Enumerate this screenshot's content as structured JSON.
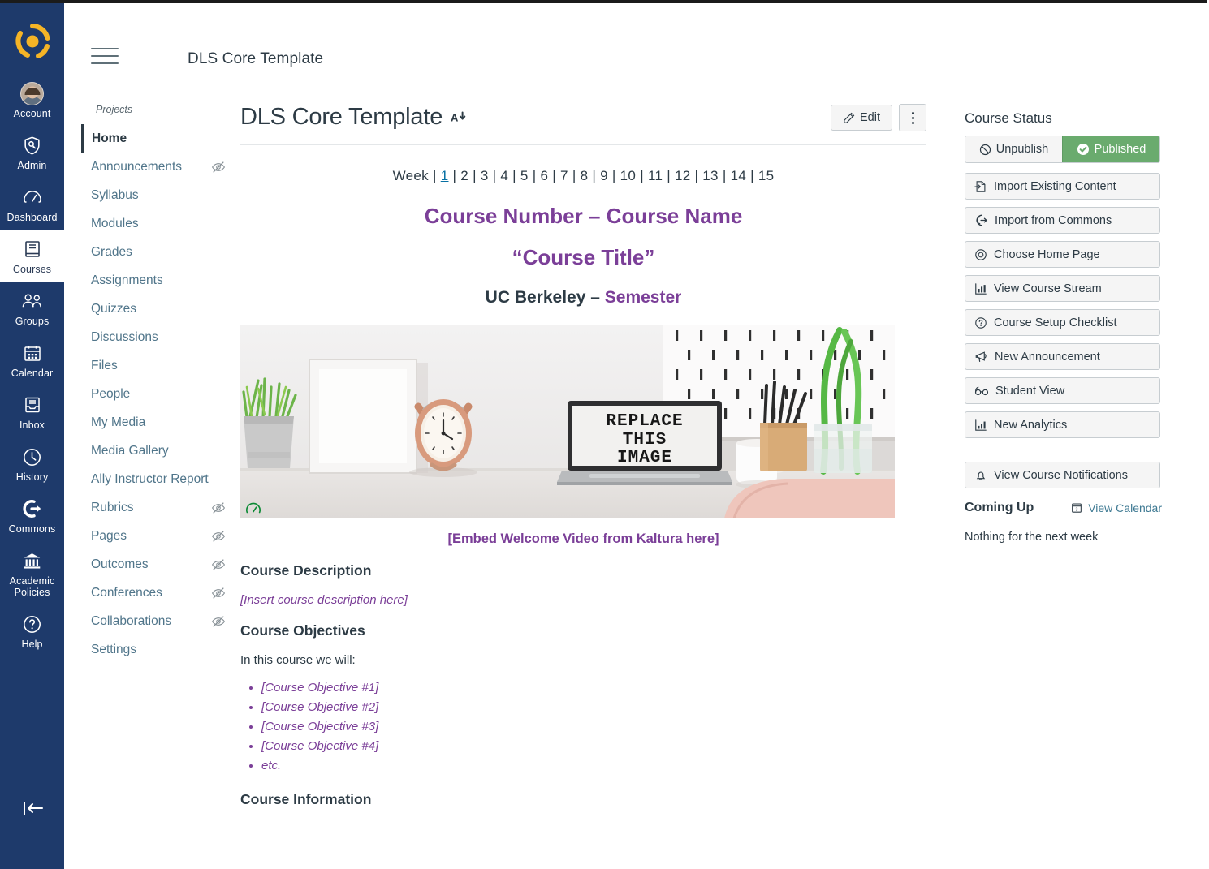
{
  "global_nav": {
    "logo_name": "canvas-logo",
    "items": [
      {
        "label": "Account",
        "icon": "user-avatar",
        "active": false
      },
      {
        "label": "Admin",
        "icon": "shield-admin-icon",
        "active": false
      },
      {
        "label": "Dashboard",
        "icon": "dashboard-gauge-icon",
        "active": false
      },
      {
        "label": "Courses",
        "icon": "book-icon",
        "active": true
      },
      {
        "label": "Groups",
        "icon": "groups-people-icon",
        "active": false
      },
      {
        "label": "Calendar",
        "icon": "calendar-icon",
        "active": false
      },
      {
        "label": "Inbox",
        "icon": "inbox-tray-icon",
        "active": false
      },
      {
        "label": "History",
        "icon": "clock-history-icon",
        "active": false
      },
      {
        "label": "Commons",
        "icon": "arrow-out-circle-icon",
        "active": false
      },
      {
        "label": "Academic Policies",
        "icon": "institution-bank-icon",
        "active": false
      },
      {
        "label": "Help",
        "icon": "question-circle-icon",
        "active": false
      }
    ],
    "collapse_label": "collapse-nav-icon"
  },
  "course_header": {
    "menu_icon": "hamburger-menu-icon",
    "title": "DLS Core Template"
  },
  "course_nav": {
    "breadcrumb": "Projects",
    "items": [
      {
        "label": "Home",
        "active": true,
        "hidden_icon": false
      },
      {
        "label": "Announcements",
        "active": false,
        "hidden_icon": true
      },
      {
        "label": "Syllabus",
        "active": false,
        "hidden_icon": false
      },
      {
        "label": "Modules",
        "active": false,
        "hidden_icon": false
      },
      {
        "label": "Grades",
        "active": false,
        "hidden_icon": false
      },
      {
        "label": "Assignments",
        "active": false,
        "hidden_icon": false
      },
      {
        "label": "Quizzes",
        "active": false,
        "hidden_icon": false
      },
      {
        "label": "Discussions",
        "active": false,
        "hidden_icon": false
      },
      {
        "label": "Files",
        "active": false,
        "hidden_icon": false
      },
      {
        "label": "People",
        "active": false,
        "hidden_icon": false
      },
      {
        "label": "My Media",
        "active": false,
        "hidden_icon": false
      },
      {
        "label": "Media Gallery",
        "active": false,
        "hidden_icon": false
      },
      {
        "label": "Ally Instructor Report",
        "active": false,
        "hidden_icon": false
      },
      {
        "label": "Rubrics",
        "active": false,
        "hidden_icon": true
      },
      {
        "label": "Pages",
        "active": false,
        "hidden_icon": true
      },
      {
        "label": "Outcomes",
        "active": false,
        "hidden_icon": true
      },
      {
        "label": "Conferences",
        "active": false,
        "hidden_icon": true
      },
      {
        "label": "Collaborations",
        "active": false,
        "hidden_icon": true
      },
      {
        "label": "Settings",
        "active": false,
        "hidden_icon": false
      }
    ]
  },
  "page": {
    "title": "DLS Core Template",
    "ally_indicator": "A",
    "edit_label": "Edit",
    "kebab_label": "page-options-menu",
    "week_nav_label": "Week",
    "week_current": "1",
    "weeks": [
      "2",
      "3",
      "4",
      "5",
      "6",
      "7",
      "8",
      "9",
      "10",
      "11",
      "12",
      "13",
      "14",
      "15"
    ],
    "course_line_1": "Course Number – Course Name",
    "course_line_2": "“Course Title”",
    "institution": "UC Berkeley – ",
    "semester": "Semester",
    "hero_image_text": [
      "REPLACE",
      "THIS",
      "IMAGE"
    ],
    "embed_line": "[Embed Welcome Video from Kaltura here]",
    "description_heading": "Course Description",
    "description_placeholder": "[Insert course description here]",
    "objectives_heading": "Course Objectives",
    "objectives_intro": "In this course we will:",
    "objectives": [
      "[Course Objective #1]",
      "[Course Objective #2]",
      "[Course Objective #3]",
      "[Course Objective #4]",
      "etc."
    ],
    "information_heading": "Course Information"
  },
  "right_sidebar": {
    "status_heading": "Course Status",
    "unpublish_label": "Unpublish",
    "published_label": "Published",
    "buttons_group_1": [
      {
        "label": "Import Existing Content",
        "icon": "import-content-icon"
      },
      {
        "label": "Import from Commons",
        "icon": "commons-icon"
      },
      {
        "label": "Choose Home Page",
        "icon": "target-circle-icon"
      },
      {
        "label": "View Course Stream",
        "icon": "chart-stream-icon"
      },
      {
        "label": "Course Setup Checklist",
        "icon": "question-circle-icon"
      },
      {
        "label": "New Announcement",
        "icon": "megaphone-icon"
      },
      {
        "label": "Student View",
        "icon": "glasses-icon"
      },
      {
        "label": "New Analytics",
        "icon": "analytics-chart-icon"
      }
    ],
    "buttons_group_2": [
      {
        "label": "View Course Notifications",
        "icon": "bell-icon"
      }
    ],
    "coming_up_title": "Coming Up",
    "view_calendar_label": "View Calendar",
    "view_calendar_icon": "calendar-icon",
    "coming_up_empty": "Nothing for the next week"
  },
  "colors": {
    "nav_blue": "#1e3a6b",
    "logo_gold": "#f5b426",
    "purple": "#7b3f98",
    "published_green": "#6aab6e",
    "link_blue": "#3f7a93"
  }
}
